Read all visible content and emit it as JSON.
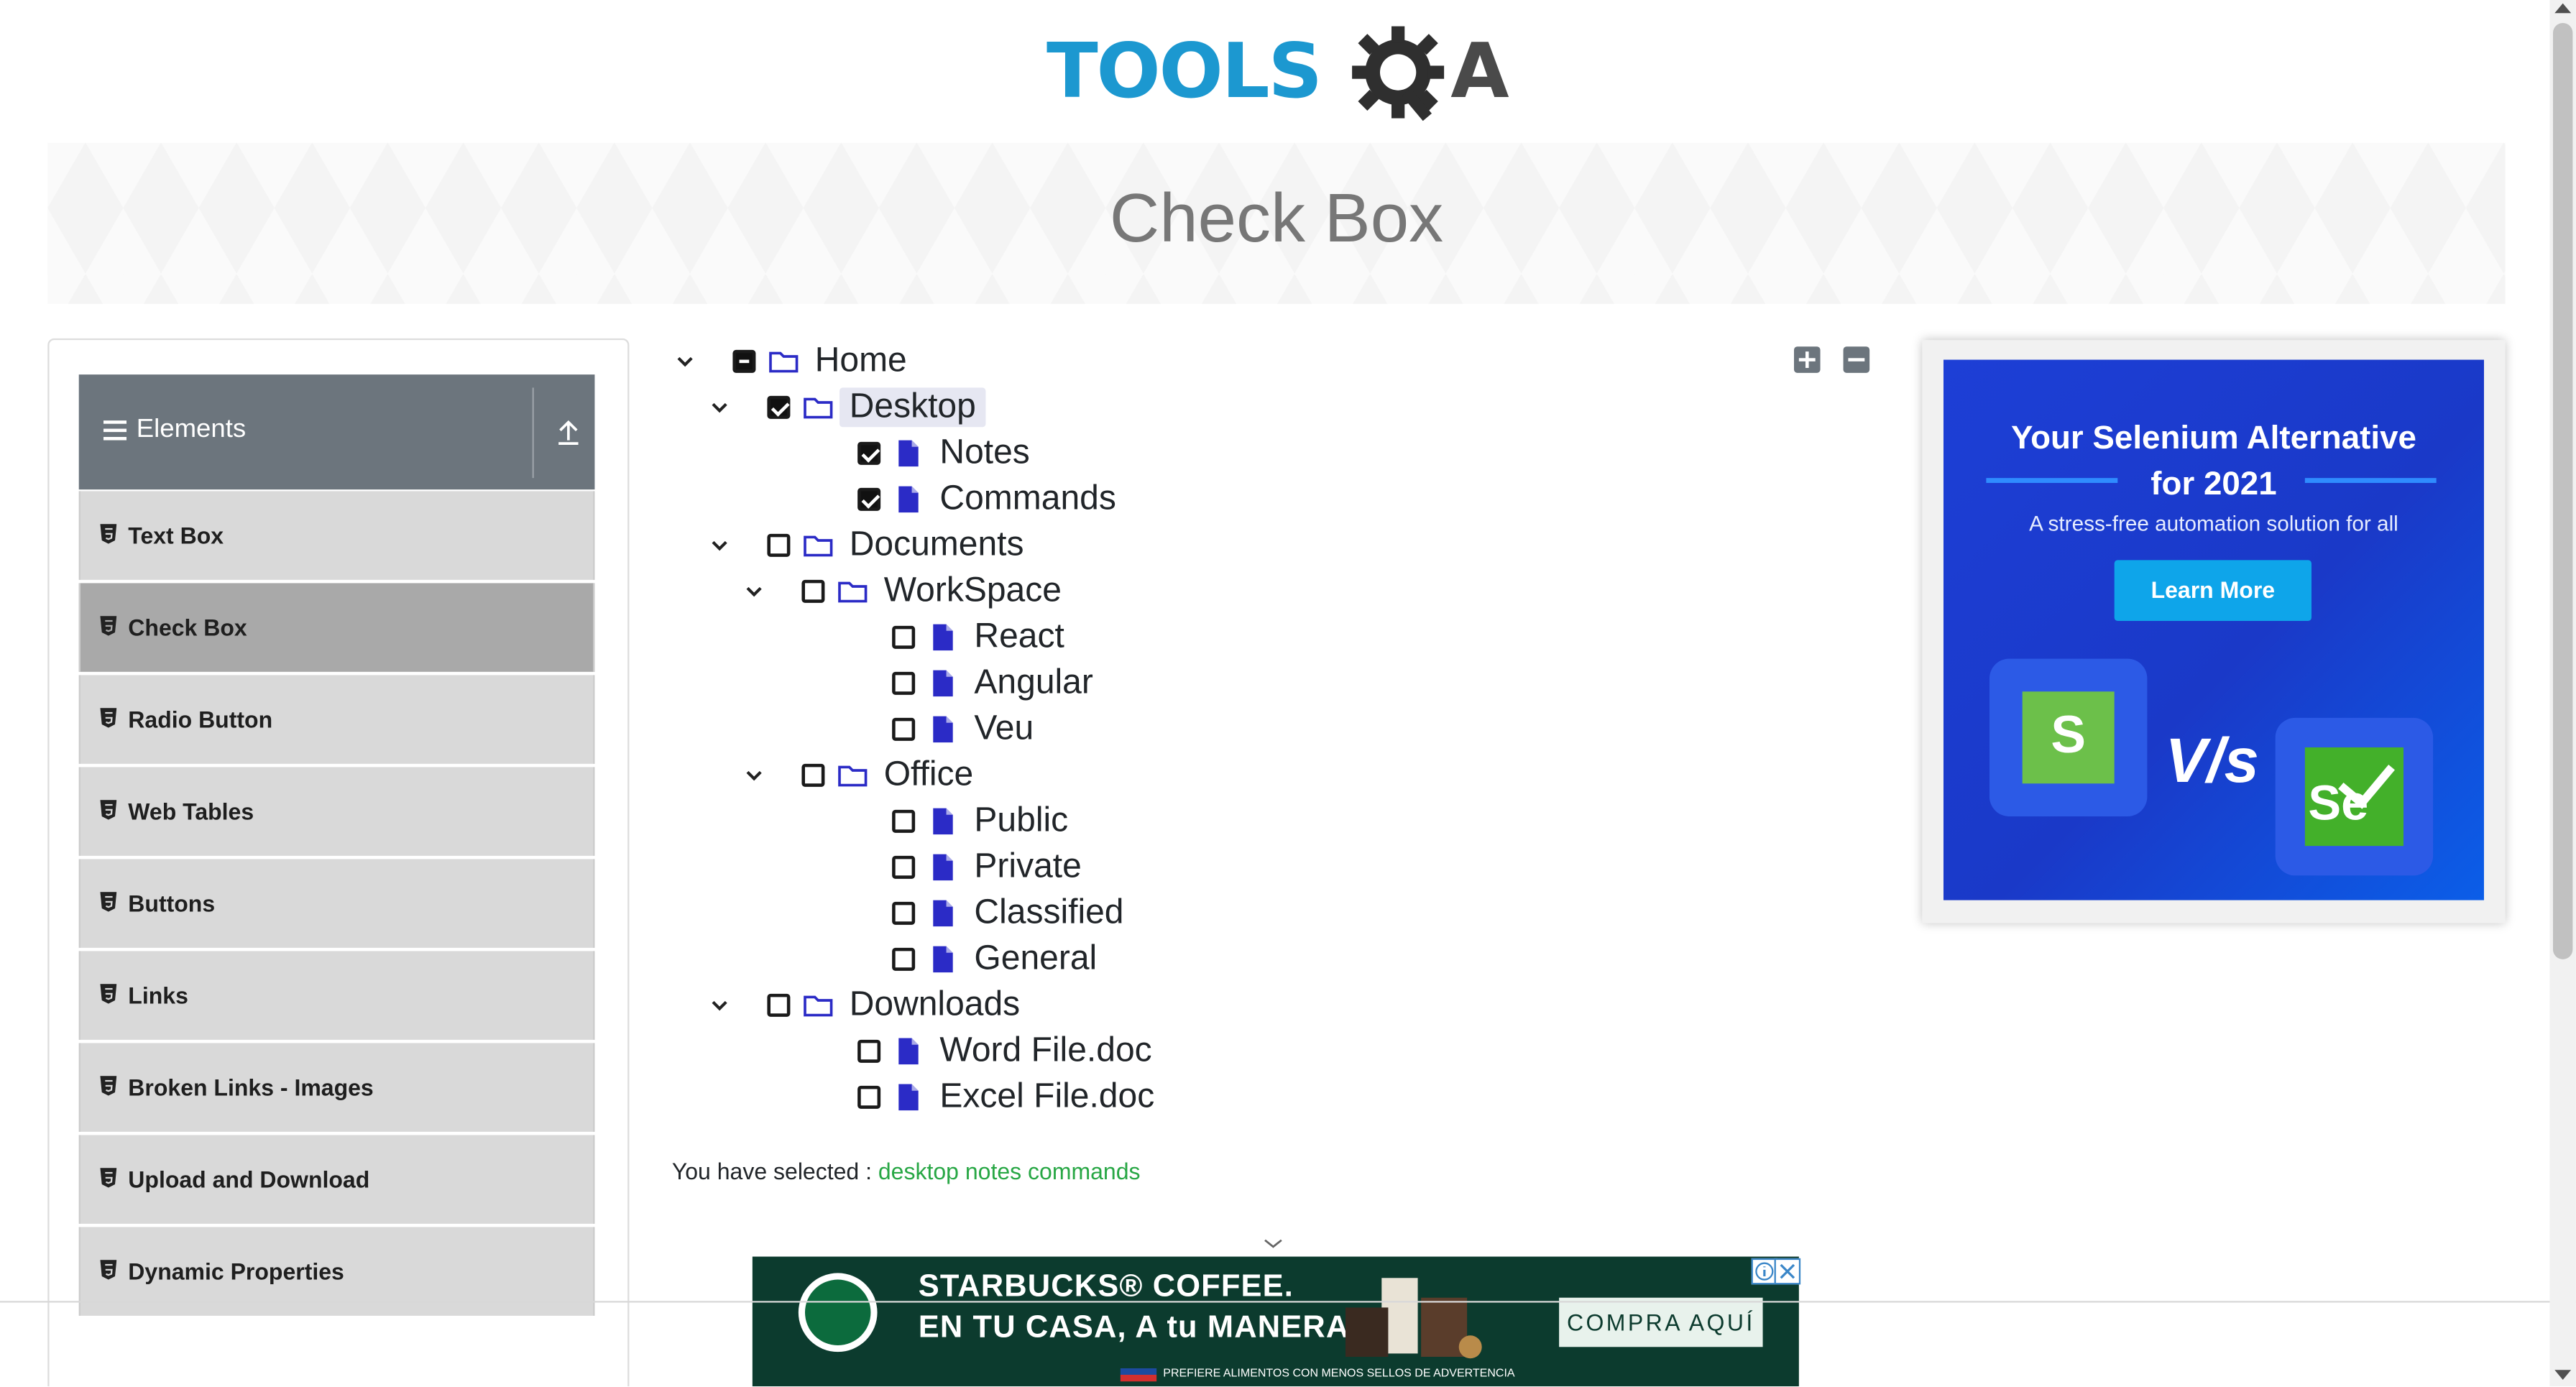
{
  "header": {
    "logo_text": "TOOLS",
    "logo_suffix": "A",
    "page_title": "Check Box"
  },
  "sidebar": {
    "group_title": "Elements",
    "items": [
      {
        "label": "Text Box",
        "active": false
      },
      {
        "label": "Check Box",
        "active": true
      },
      {
        "label": "Radio Button",
        "active": false
      },
      {
        "label": "Web Tables",
        "active": false
      },
      {
        "label": "Buttons",
        "active": false
      },
      {
        "label": "Links",
        "active": false
      },
      {
        "label": "Broken Links - Images",
        "active": false
      },
      {
        "label": "Upload and Download",
        "active": false
      },
      {
        "label": "Dynamic Properties",
        "active": false
      }
    ]
  },
  "tree": {
    "nodes": [
      {
        "label": "Home",
        "type": "folder",
        "state": "half",
        "level": 0,
        "expanded": true
      },
      {
        "label": "Desktop",
        "type": "folder",
        "state": "checked",
        "level": 1,
        "expanded": true,
        "highlight": true
      },
      {
        "label": "Notes",
        "type": "file",
        "state": "checked",
        "level": 2
      },
      {
        "label": "Commands",
        "type": "file",
        "state": "checked",
        "level": 2
      },
      {
        "label": "Documents",
        "type": "folder",
        "state": "unchecked",
        "level": 1,
        "expanded": true
      },
      {
        "label": "WorkSpace",
        "type": "folder",
        "state": "unchecked",
        "level": 2,
        "expanded": true
      },
      {
        "label": "React",
        "type": "file",
        "state": "unchecked",
        "level": 3
      },
      {
        "label": "Angular",
        "type": "file",
        "state": "unchecked",
        "level": 3
      },
      {
        "label": "Veu",
        "type": "file",
        "state": "unchecked",
        "level": 3
      },
      {
        "label": "Office",
        "type": "folder",
        "state": "unchecked",
        "level": 2,
        "expanded": true
      },
      {
        "label": "Public",
        "type": "file",
        "state": "unchecked",
        "level": 3
      },
      {
        "label": "Private",
        "type": "file",
        "state": "unchecked",
        "level": 3
      },
      {
        "label": "Classified",
        "type": "file",
        "state": "unchecked",
        "level": 3
      },
      {
        "label": "General",
        "type": "file",
        "state": "unchecked",
        "level": 3
      },
      {
        "label": "Downloads",
        "type": "folder",
        "state": "unchecked",
        "level": 1,
        "expanded": true
      },
      {
        "label": "Word File.doc",
        "type": "file",
        "state": "unchecked",
        "level": 2
      },
      {
        "label": "Excel File.doc",
        "type": "file",
        "state": "unchecked",
        "level": 2
      }
    ],
    "expand_all_icon": "plus-square-icon",
    "collapse_all_icon": "minus-square-icon"
  },
  "result": {
    "prefix": "You have selected :",
    "values": "desktop notes commands"
  },
  "ad_side": {
    "title_line1": "Your Selenium Alternative",
    "title_line2": "for 2021",
    "subtitle": "A stress-free automation solution for all",
    "button": "Learn More",
    "vs_text": "V/s",
    "left_logo": "S",
    "right_logo": "Se"
  },
  "ad_bottom": {
    "line1": "STARBUCKS® COFFEE.",
    "line2": "EN TU CASA, A tu MANERA",
    "cta": "COMPRA AQUÍ",
    "legal": "PREFIERE ALIMENTOS CON MENOS SELLOS DE ADVERTENCIA"
  },
  "colors": {
    "accent_blue": "#1c98d0",
    "tree_icon": "#2b2bc6",
    "selected_green": "#28a745",
    "sidebar_header": "#6c757d"
  }
}
